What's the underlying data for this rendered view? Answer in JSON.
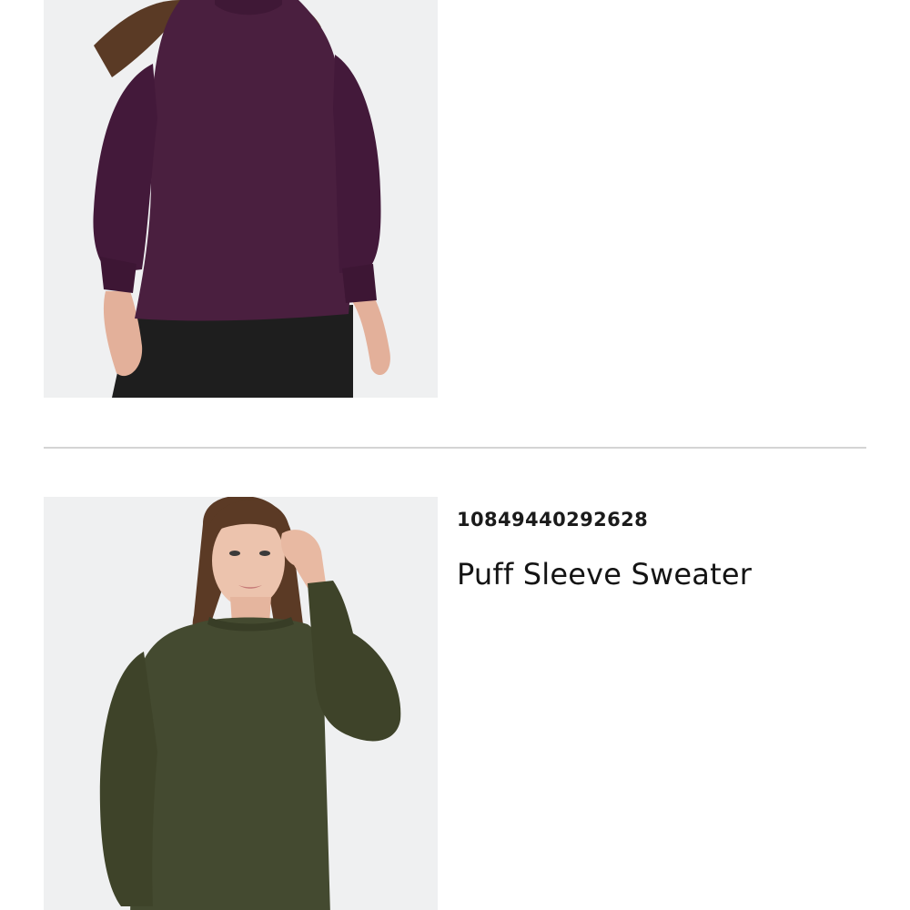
{
  "colors": {
    "accent_top_item": "#4a1f3f",
    "accent_bottom_item": "#444a30",
    "divider": "#d4d4d4",
    "image_background": "#eff0f1"
  },
  "products": [
    {
      "image_icon": "model-wearing-plum-sweater-photo",
      "id": "",
      "name": ""
    },
    {
      "image_icon": "model-wearing-olive-sweater-photo",
      "id": "10849440292628",
      "name": "Puff Sleeve Sweater"
    }
  ]
}
